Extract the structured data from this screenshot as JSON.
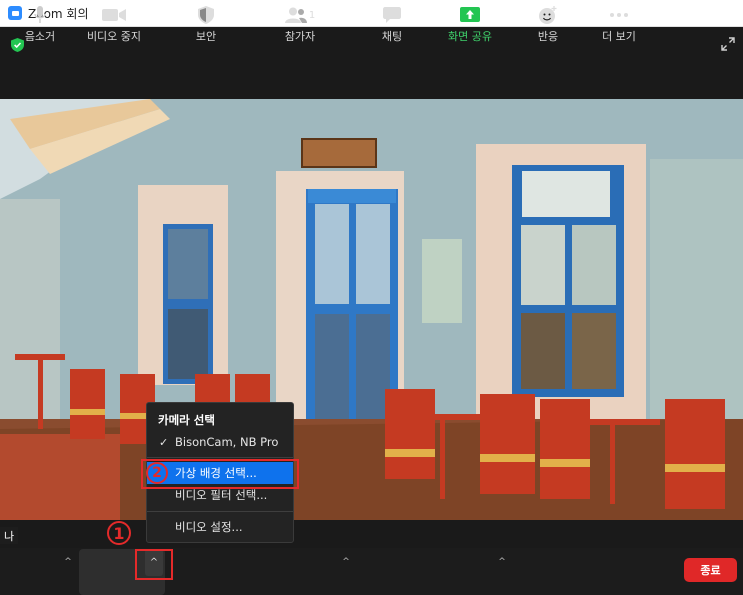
{
  "window": {
    "title": "Zoom 회의"
  },
  "self_view_label": "나",
  "toolbar": {
    "mute_label": "음소거",
    "video_label": "비디오 중지",
    "security_label": "보안",
    "participants_label": "참가자",
    "participants_count": "1",
    "chat_label": "채팅",
    "share_label": "화면 공유",
    "reactions_label": "반응",
    "more_label": "더 보기",
    "end_label": "종료"
  },
  "camera_menu": {
    "heading": "카메라 선택",
    "camera_name": "BisonCam, NB Pro",
    "virtual_bg": "가상 배경 선택...",
    "video_filter": "비디오 필터 선택...",
    "video_settings": "비디오 설정..."
  },
  "annotations": {
    "step1": "1",
    "step2": "2"
  },
  "colors": {
    "accent": "#0e72ed",
    "end": "#e02828",
    "share_green": "#3fd26b",
    "annotation_red": "#e42a2a"
  }
}
